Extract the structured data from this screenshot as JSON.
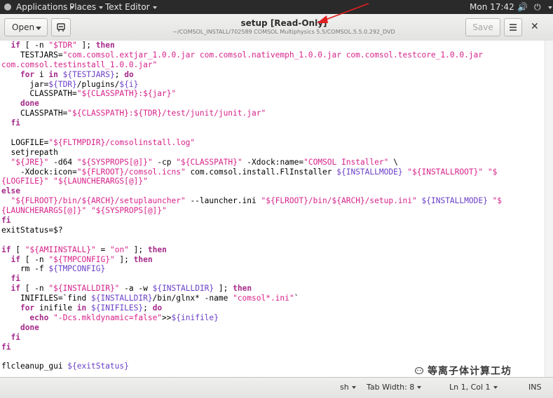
{
  "topbar": {
    "applications": "Applications",
    "places": "Places",
    "app_name": "Text Editor",
    "clock": "Mon 17:42"
  },
  "header": {
    "open_label": "Open",
    "save_label": "Save",
    "title": "setup [Read-Only]",
    "path": "~/COMSOL_INSTALL/702589 COMSOL Multiphysics 5.5/COMSOL.5.5.0.292_DVD"
  },
  "code_lines": [
    [
      [
        "  ",
        ""
      ],
      [
        "if",
        "k"
      ],
      [
        " [ -n ",
        ""
      ],
      [
        "\"$TDR\"",
        "s"
      ],
      [
        " ]; ",
        ""
      ],
      [
        "then",
        "k"
      ]
    ],
    [
      [
        "    TESTJARS=",
        ""
      ],
      [
        "\"com.comsol.extjar_1.0.0.jar com.comsol.nativemph_1.0.0.jar com.comsol.testcore_1.0.0.jar",
        "s"
      ]
    ],
    [
      [
        "com.comsol.testinstall_1.0.0.jar\"",
        "s"
      ]
    ],
    [
      [
        "    ",
        ""
      ],
      [
        "for",
        "k"
      ],
      [
        " i ",
        ""
      ],
      [
        "in",
        "k"
      ],
      [
        " ",
        ""
      ],
      [
        "${TESTJARS}",
        "v"
      ],
      [
        "; ",
        ""
      ],
      [
        "do",
        "k"
      ]
    ],
    [
      [
        "      jar=",
        ""
      ],
      [
        "${TDR}",
        "v"
      ],
      [
        "/plugins/",
        ""
      ],
      [
        "${i}",
        "v"
      ]
    ],
    [
      [
        "      CLASSPATH=",
        ""
      ],
      [
        "\"${CLASSPATH}:${jar}\"",
        "s"
      ]
    ],
    [
      [
        "    ",
        ""
      ],
      [
        "done",
        "k"
      ]
    ],
    [
      [
        "    CLASSPATH=",
        ""
      ],
      [
        "\"${CLASSPATH}:${TDR}/test/junit/junit.jar\"",
        "s"
      ]
    ],
    [
      [
        "  ",
        ""
      ],
      [
        "fi",
        "k"
      ]
    ],
    [
      [
        "",
        ""
      ]
    ],
    [
      [
        "  LOGFILE=",
        ""
      ],
      [
        "\"${FLTMPDIR}/comsolinstall.log\"",
        "s"
      ]
    ],
    [
      [
        "  setjrepath",
        ""
      ]
    ],
    [
      [
        "  ",
        ""
      ],
      [
        "\"${JRE}\"",
        "s"
      ],
      [
        " -d64 ",
        ""
      ],
      [
        "\"${SYSPROPS[@]}\"",
        "s"
      ],
      [
        " -cp ",
        ""
      ],
      [
        "\"${CLASSPATH}\"",
        "s"
      ],
      [
        " -Xdock:name=",
        ""
      ],
      [
        "\"COMSOL Installer\"",
        "s"
      ],
      [
        " \\",
        ""
      ]
    ],
    [
      [
        "    -Xdock:icon=",
        ""
      ],
      [
        "\"${FLROOT}/comsol.icns\"",
        "s"
      ],
      [
        " com.comsol.install.FlInstaller ",
        ""
      ],
      [
        "${INSTALLMODE}",
        "v"
      ],
      [
        " ",
        ""
      ],
      [
        "\"${INSTALLROOT}\"",
        "s"
      ],
      [
        " ",
        ""
      ],
      [
        "\"$",
        "s"
      ]
    ],
    [
      [
        "{LOGFILE}\"",
        "s"
      ],
      [
        " ",
        ""
      ],
      [
        "\"${LAUNCHERARGS[@]}\"",
        "s"
      ]
    ],
    [
      [
        "else",
        "k"
      ]
    ],
    [
      [
        "  ",
        ""
      ],
      [
        "\"${FLROOT}/bin/${ARCH}/setuplauncher\"",
        "s"
      ],
      [
        " --launcher.ini ",
        ""
      ],
      [
        "\"${FLROOT}/bin/${ARCH}/setup.ini\"",
        "s"
      ],
      [
        " ",
        ""
      ],
      [
        "${INSTALLMODE}",
        "v"
      ],
      [
        " ",
        ""
      ],
      [
        "\"$",
        "s"
      ]
    ],
    [
      [
        "{LAUNCHERARGS[@]}\"",
        "s"
      ],
      [
        " ",
        ""
      ],
      [
        "\"${SYSPROPS[@]}\"",
        "s"
      ]
    ],
    [
      [
        "fi",
        "k"
      ]
    ],
    [
      [
        "exitStatus=$?",
        ""
      ]
    ],
    [
      [
        "",
        ""
      ]
    ],
    [
      [
        "if",
        "k"
      ],
      [
        " [ ",
        ""
      ],
      [
        "\"${AMIINSTALL}\"",
        "s"
      ],
      [
        " = ",
        ""
      ],
      [
        "\"on\"",
        "s"
      ],
      [
        " ]; ",
        ""
      ],
      [
        "then",
        "k"
      ]
    ],
    [
      [
        "  ",
        ""
      ],
      [
        "if",
        "k"
      ],
      [
        " [ -n ",
        ""
      ],
      [
        "\"${TMPCONFIG}\"",
        "s"
      ],
      [
        " ]; ",
        ""
      ],
      [
        "then",
        "k"
      ]
    ],
    [
      [
        "    rm -f ",
        ""
      ],
      [
        "${TMPCONFIG}",
        "v"
      ]
    ],
    [
      [
        "  ",
        ""
      ],
      [
        "fi",
        "k"
      ]
    ],
    [
      [
        "  ",
        ""
      ],
      [
        "if",
        "k"
      ],
      [
        " [ -n ",
        ""
      ],
      [
        "\"${INSTALLDIR}\"",
        "s"
      ],
      [
        " -a -w ",
        ""
      ],
      [
        "${INSTALLDIR}",
        "v"
      ],
      [
        " ]; ",
        ""
      ],
      [
        "then",
        "k"
      ]
    ],
    [
      [
        "    INIFILES=`find ",
        ""
      ],
      [
        "${INSTALLDIR}",
        "v"
      ],
      [
        "/bin/glnx* -name ",
        ""
      ],
      [
        "\"comsol*.ini\"",
        "s"
      ],
      [
        "`",
        ""
      ]
    ],
    [
      [
        "    ",
        ""
      ],
      [
        "for",
        "k"
      ],
      [
        " inifile ",
        ""
      ],
      [
        "in",
        "k"
      ],
      [
        " ",
        ""
      ],
      [
        "${INIFILES}",
        "v"
      ],
      [
        "; ",
        ""
      ],
      [
        "do",
        "k"
      ]
    ],
    [
      [
        "      ",
        ""
      ],
      [
        "echo",
        "k"
      ],
      [
        " ",
        ""
      ],
      [
        "\"-Dcs.mkldynamic=false\"",
        "s"
      ],
      [
        ">>",
        ""
      ],
      [
        "${inifile}",
        "v"
      ]
    ],
    [
      [
        "    ",
        ""
      ],
      [
        "done",
        "k"
      ]
    ],
    [
      [
        "  ",
        ""
      ],
      [
        "fi",
        "k"
      ]
    ],
    [
      [
        "fi",
        "k"
      ]
    ],
    [
      [
        "",
        ""
      ]
    ],
    [
      [
        "flcleanup_gui ",
        ""
      ],
      [
        "${exitStatus}",
        "v"
      ]
    ]
  ],
  "statusbar": {
    "language": "sh",
    "tab_width": "Tab Width: 8",
    "position": "Ln 1, Col 1",
    "mode": "INS"
  },
  "watermark": "等离子体计算工坊",
  "colors": {
    "keyword": "#a52a8a",
    "string": "#d7228a",
    "variable": "#6a3fc7",
    "annotation_arrow": "#e02020"
  }
}
